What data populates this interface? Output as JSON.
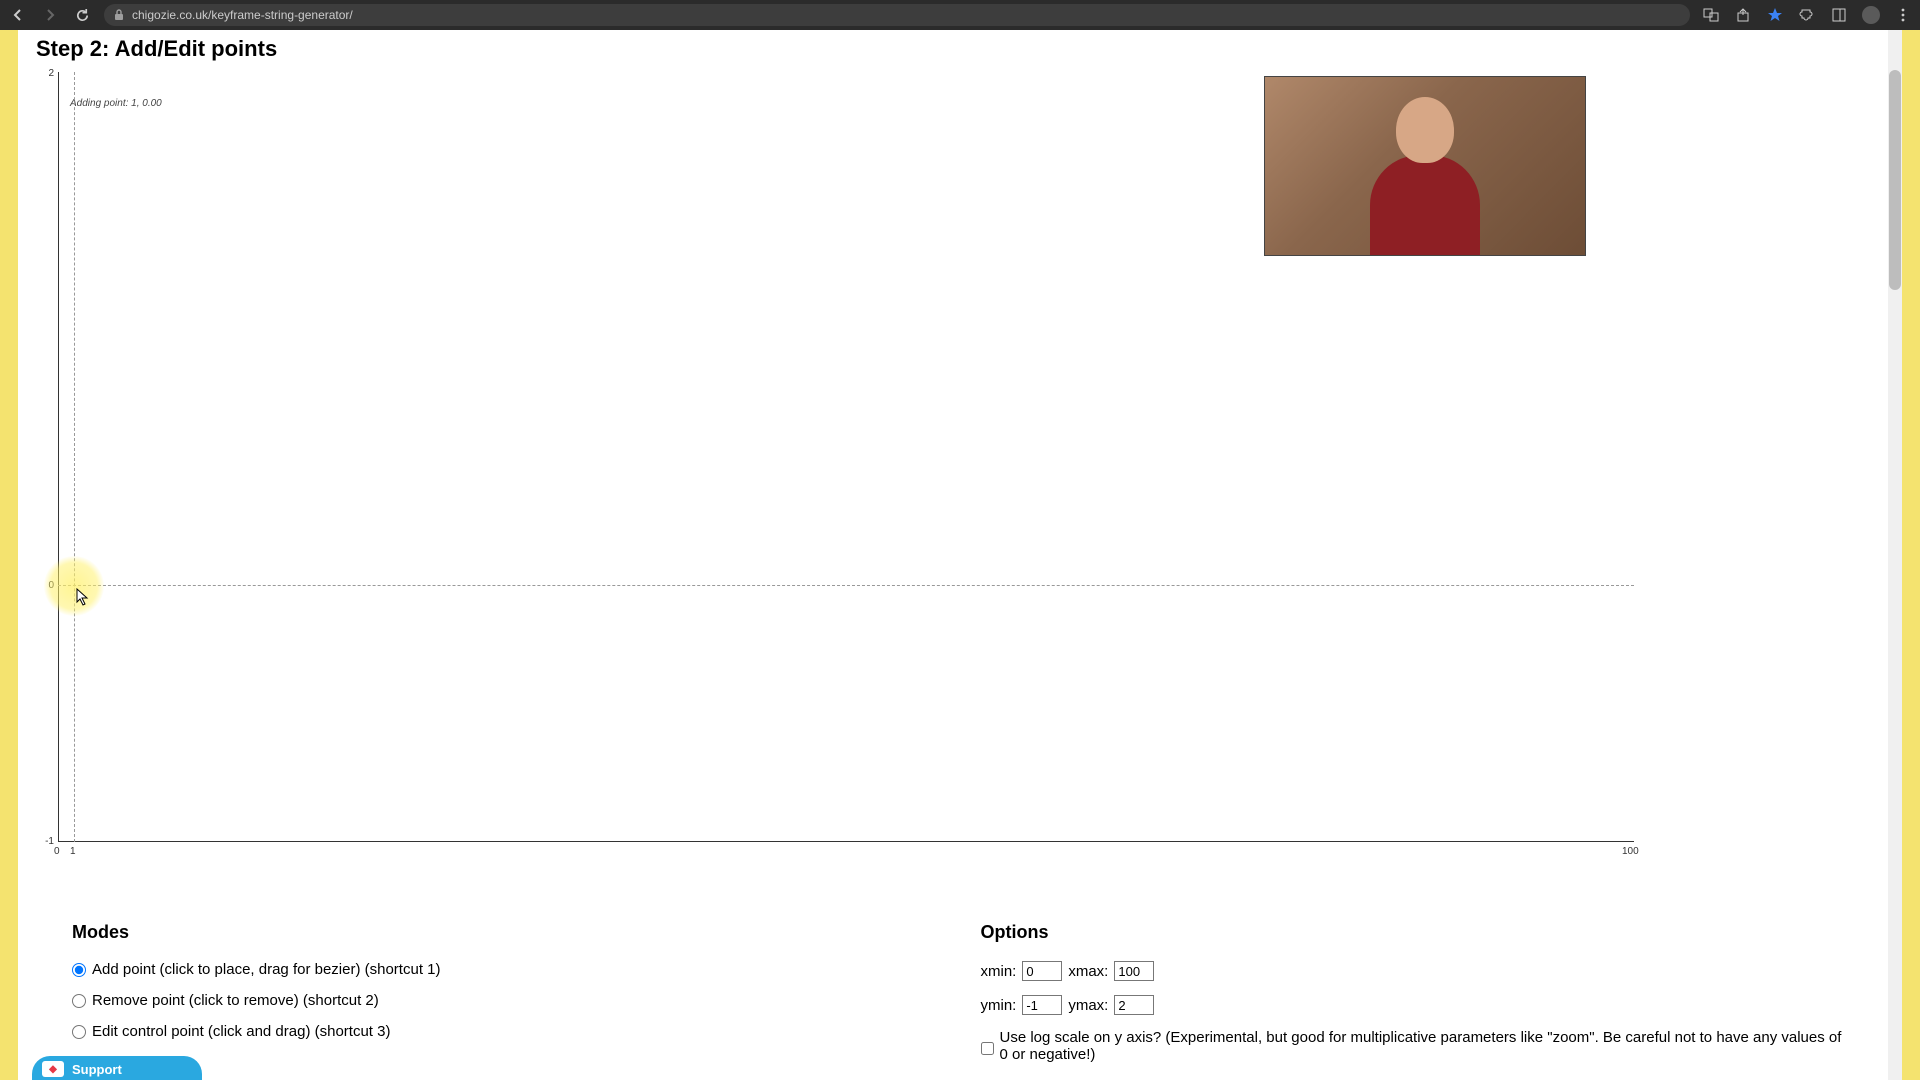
{
  "browser": {
    "url": "chigozie.co.uk/keyframe-string-generator/"
  },
  "page_title": "Step 2: Add/Edit points",
  "chart_data": {
    "type": "scatter",
    "x": [
      1
    ],
    "y": [
      0.0
    ],
    "xlim": [
      0,
      100
    ],
    "ylim": [
      -1.0,
      2.0
    ],
    "x_ticks": [
      0,
      1,
      100
    ],
    "y_ticks": [
      -1.0,
      0.0,
      2.0
    ],
    "crosshair": {
      "x": 1,
      "y": 0.0
    },
    "tooltip": "Adding point: 1, 0.00"
  },
  "modes": {
    "heading": "Modes",
    "items": [
      {
        "label": "Add point (click to place, drag for bezier) (shortcut 1)",
        "checked": true
      },
      {
        "label": "Remove point (click to remove) (shortcut 2)",
        "checked": false
      },
      {
        "label": "Edit control point (click and drag) (shortcut 3)",
        "checked": false
      }
    ]
  },
  "options": {
    "heading": "Options",
    "xmin_label": "xmin:",
    "xmin_value": "0",
    "xmax_label": "xmax:",
    "xmax_value": "100",
    "ymin_label": "ymin:",
    "ymin_value": "-1",
    "ymax_label": "ymax:",
    "ymax_value": "2",
    "logscale_label": "Use log scale on y axis? (Experimental, but good for multiplicative parameters like \"zoom\". Be careful not to have any values of 0 or negative!)",
    "logscale_checked": false
  },
  "support_label": "Support"
}
